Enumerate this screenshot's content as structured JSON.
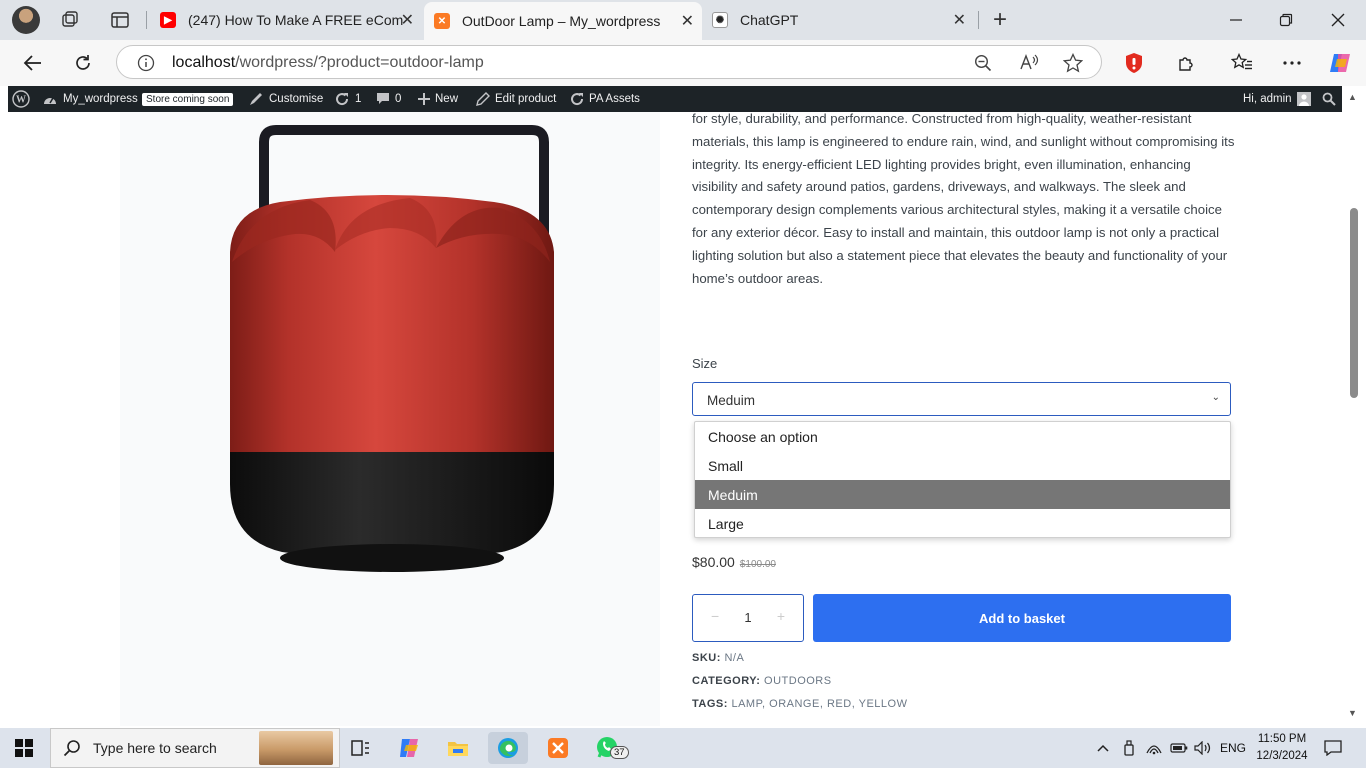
{
  "browser": {
    "tabs": [
      {
        "title": "(247) How To Make A FREE eCom",
        "icon": "youtube-icon",
        "color": "#ff0000"
      },
      {
        "title": "OutDoor Lamp – My_wordpress",
        "icon": "xampp-icon",
        "color": "#fb7a24",
        "active": true
      },
      {
        "title": "ChatGPT",
        "icon": "chatgpt-icon",
        "color": "#222222"
      }
    ],
    "close_glyph": "✕",
    "new_tab_glyph": "+",
    "url_host": "localhost",
    "url_path": "/wordpress/?product=outdoor-lamp"
  },
  "adminbar": {
    "site_name": "My_wordpress",
    "store_badge": "Store coming soon",
    "customise": "Customise",
    "updates_count": "1",
    "comments_count": "0",
    "new_label": "New",
    "edit_product": "Edit product",
    "pa_assets": "PA Assets",
    "greeting": "Hi, admin"
  },
  "product": {
    "description": "for style, durability, and performance. Constructed from high-quality, weather-resistant materials, this lamp is engineered to endure rain, wind, and sunlight without compromising its integrity. Its energy-efficient LED lighting provides bright, even illumination, enhancing visibility and safety around patios, gardens, driveways, and walkways. The sleek and contemporary design complements various architectural styles, making it a versatile choice for any exterior décor. Easy to install and maintain, this outdoor lamp is not only a practical lighting solution but also a statement piece that elevates the beauty and functionality of your home’s outdoor areas.",
    "size_label": "Size",
    "size_selected": "Meduim",
    "size_options": [
      "Choose an option",
      "Small",
      "Meduim",
      "Large"
    ],
    "price": "$80.00",
    "regular_price": "$100.00",
    "quantity": "1",
    "qty_minus": "−",
    "qty_plus": "+",
    "add_to_basket": "Add to basket",
    "sku_label": "SKU:",
    "sku_value": "N/A",
    "category_label": "CATEGORY:",
    "category_value": "OUTDOORS",
    "tags_label": "TAGS:",
    "tags": [
      "LAMP",
      "ORANGE",
      "RED",
      "YELLOW"
    ],
    "lamp_color": "#b8322a",
    "accent_color": "#2d6ff0"
  },
  "taskbar": {
    "search_placeholder": "Type here to search",
    "whatsapp_badge": "37",
    "language": "ENG",
    "time": "11:50 PM",
    "date": "12/3/2024"
  }
}
